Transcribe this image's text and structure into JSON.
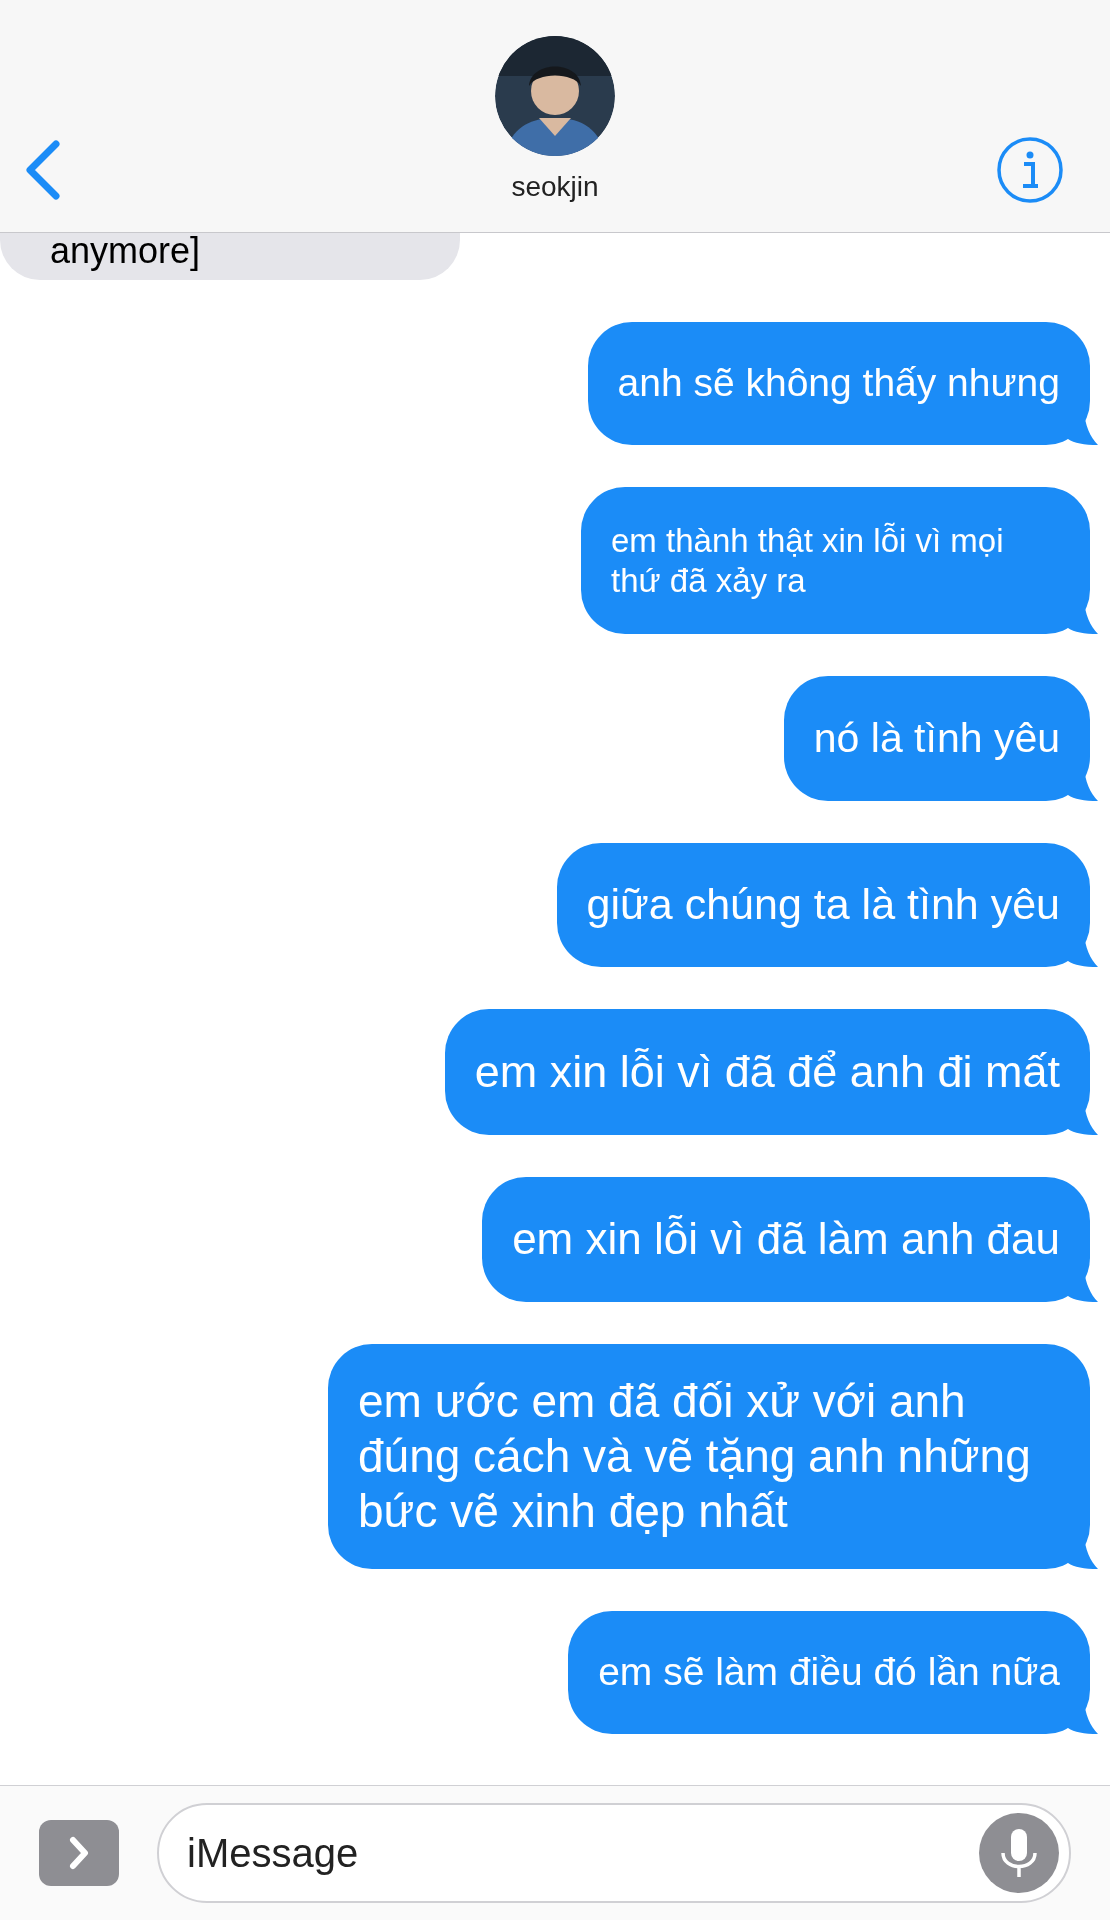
{
  "header": {
    "contact_name": "seokjin"
  },
  "messages": [
    {
      "kind": "received",
      "text": "anymore]"
    },
    {
      "kind": "sent",
      "text": "anh sẽ không thấy nhưng"
    },
    {
      "kind": "sent",
      "text": "em thành thật xin lỗi vì mọi thứ đã xảy ra"
    },
    {
      "kind": "sent",
      "text": "nó là tình yêu"
    },
    {
      "kind": "sent",
      "text": "giữa chúng ta là tình yêu"
    },
    {
      "kind": "sent",
      "text": "em xin lỗi vì đã để anh đi mất"
    },
    {
      "kind": "sent",
      "text": "em xin lỗi vì đã làm anh đau"
    },
    {
      "kind": "sent",
      "text": "em ước em đã đối xử với anh đúng cách và vẽ tặng anh những bức vẽ xinh đẹp nhất"
    },
    {
      "kind": "sent",
      "text": "em sẽ làm điều đó lần nữa"
    }
  ],
  "input": {
    "placeholder": "iMessage"
  }
}
